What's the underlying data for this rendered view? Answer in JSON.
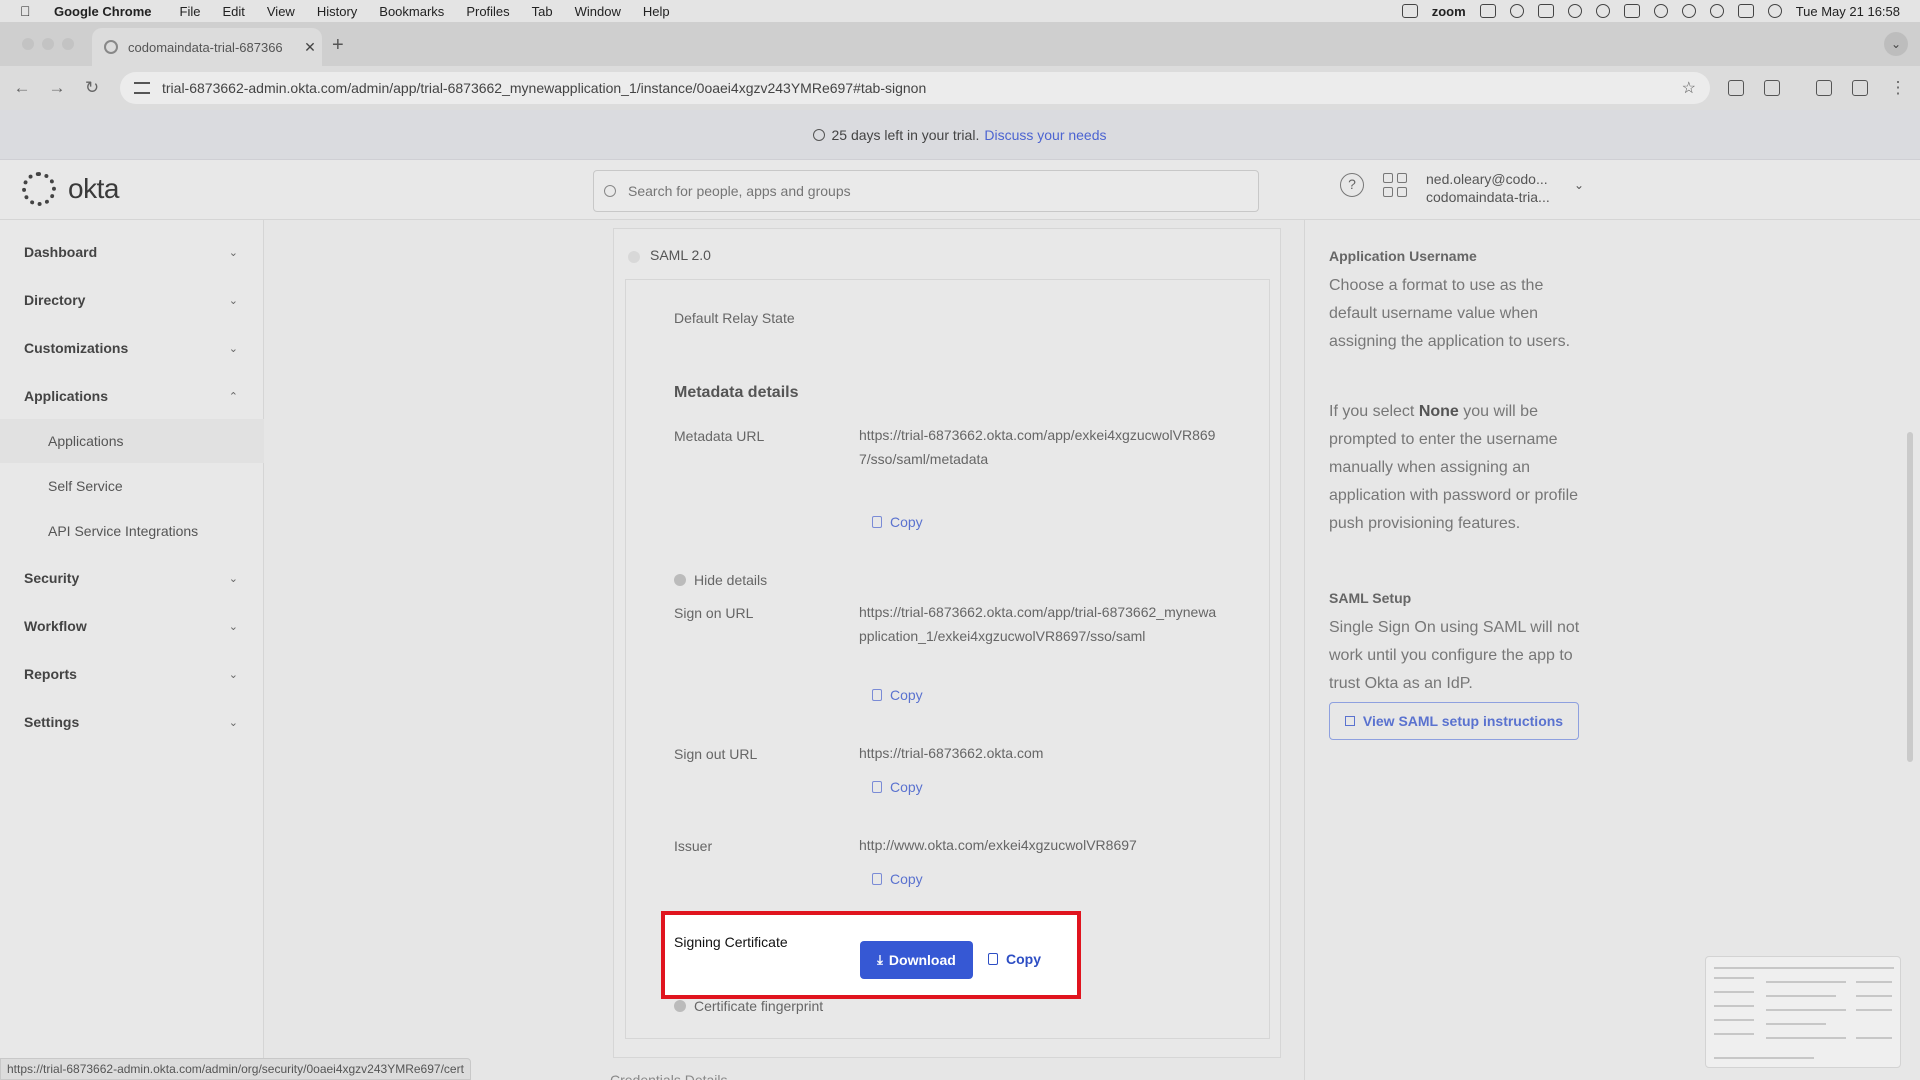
{
  "menubar": {
    "app_name": "Google Chrome",
    "items": [
      "File",
      "Edit",
      "View",
      "History",
      "Bookmarks",
      "Profiles",
      "Tab",
      "Window",
      "Help"
    ],
    "zoom_label": "zoom",
    "datetime": "Tue May 21  16:58"
  },
  "browser": {
    "tab_title": "codomaindata-trial-687366",
    "url": "trial-6873662-admin.okta.com/admin/app/trial-6873662_mynewapplication_1/instance/0oaei4xgzv243YMRe697#tab-signon",
    "status_url": "https://trial-6873662-admin.okta.com/admin/org/security/0oaei4xgzv243YMRe697/cert"
  },
  "banner": {
    "text": "25 days left in your trial.",
    "link": "Discuss your needs"
  },
  "header": {
    "logo": "okta",
    "search_placeholder": "Search for people, apps and groups",
    "user_email": "ned.oleary@codo...",
    "user_org": "codomaindata-tria..."
  },
  "sidebar": {
    "items": [
      {
        "label": "Dashboard"
      },
      {
        "label": "Directory"
      },
      {
        "label": "Customizations"
      },
      {
        "label": "Applications"
      },
      {
        "label": "Security"
      },
      {
        "label": "Workflow"
      },
      {
        "label": "Reports"
      },
      {
        "label": "Settings"
      }
    ],
    "sub_items": [
      {
        "label": "Applications"
      },
      {
        "label": "Self Service"
      },
      {
        "label": "API Service Integrations"
      }
    ]
  },
  "main": {
    "saml_label": "SAML 2.0",
    "relay_state_label": "Default Relay State",
    "metadata_title": "Metadata details",
    "metadata_url_label": "Metadata URL",
    "metadata_url_value": "https://trial-6873662.okta.com/app/exkei4xgzucwolVR8697/sso/saml/metadata",
    "copy_label": "Copy",
    "hide_details": "Hide details",
    "sign_on_label": "Sign on URL",
    "sign_on_value": "https://trial-6873662.okta.com/app/trial-6873662_mynewapplication_1/exkei4xgzucwolVR8697/sso/saml",
    "sign_out_label": "Sign out URL",
    "sign_out_value": "https://trial-6873662.okta.com",
    "issuer_label": "Issuer",
    "issuer_value": "http://www.okta.com/exkei4xgzucwolVR8697",
    "signing_cert_label": "Signing Certificate",
    "download_label": "Download",
    "cert_copy_label": "Copy",
    "fingerprint_label": "Certificate fingerprint",
    "below_title": "Credentials Details"
  },
  "help": {
    "username_title": "Application Username",
    "username_text": "Choose a format to use as the default username value when assigning the application to users.",
    "none_text_pre": "If you select ",
    "none_bold": "None",
    "none_text_post": " you will be prompted to enter the username manually when assigning an application with password or profile push provisioning features.",
    "saml_title": "SAML Setup",
    "saml_text": "Single Sign On using SAML will not work until you configure the app to trust Okta as an IdP.",
    "saml_button": "View SAML setup instructions"
  },
  "colors": {
    "primary_button": "#3658d4",
    "link": "#4c64d1",
    "highlight_border": "#e0141e"
  }
}
